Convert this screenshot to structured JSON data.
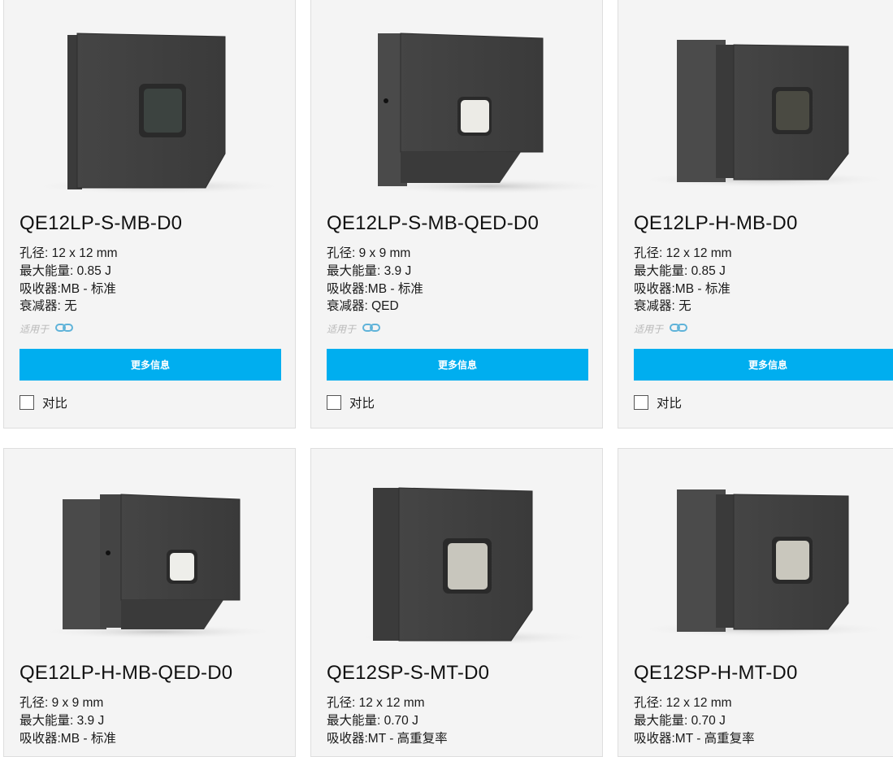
{
  "products": [
    {
      "title": "QE12LP-S-MB-D0",
      "specs": [
        "孔径: 12 x 12 mm",
        "最大能量: 0.85 J",
        "吸收器:MB - 标准",
        "衰减器: 无"
      ],
      "applies_label": "适用于",
      "more_label": "更多信息",
      "compare_label": "对比",
      "window_color": "#3c4340"
    },
    {
      "title": "QE12LP-S-MB-QED-D0",
      "specs": [
        "孔径: 9 x 9 mm",
        "最大能量: 3.9 J",
        "吸收器:MB - 标准",
        "衰减器: QED"
      ],
      "applies_label": "适用于",
      "more_label": "更多信息",
      "compare_label": "对比",
      "window_color": "#ecebe6"
    },
    {
      "title": "QE12LP-H-MB-D0",
      "specs": [
        "孔径: 12 x 12 mm",
        "最大能量: 0.85 J",
        "吸收器:MB - 标准",
        "衰减器: 无"
      ],
      "applies_label": "适用于",
      "more_label": "更多信息",
      "compare_label": "对比",
      "window_color": "#4a4a42"
    },
    {
      "title": "QE12LP-H-MB-QED-D0",
      "specs": [
        "孔径: 9 x 9 mm",
        "最大能量: 3.9 J",
        "吸收器:MB - 标准"
      ],
      "window_color": "#eeeeea"
    },
    {
      "title": "QE12SP-S-MT-D0",
      "specs": [
        "孔径: 12 x 12 mm",
        "最大能量: 0.70 J",
        "吸收器:MT - 高重复率"
      ],
      "window_color": "#c8c6bd"
    },
    {
      "title": "QE12SP-H-MT-D0",
      "specs": [
        "孔径: 12 x 12 mm",
        "最大能量: 0.70 J",
        "吸收器:MT - 高重复率"
      ],
      "window_color": "#c9c7bd"
    }
  ],
  "colors": {
    "button": "#00aeef",
    "card_bg": "#f4f4f4",
    "link_icon": "#5fb3d9"
  },
  "icons": {
    "link": "link-icon",
    "device": "detector-image"
  }
}
